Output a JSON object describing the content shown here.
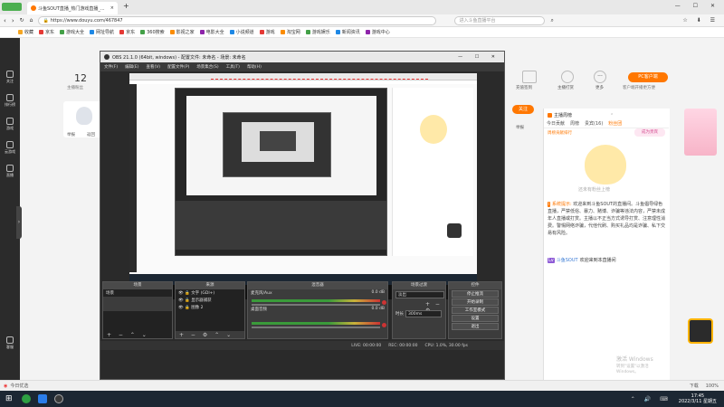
{
  "browser": {
    "brand": "360安全浏览器",
    "tab_title": "斗鱼SOUT直播_热门游戏直播_...",
    "new_tab_symbol": "+",
    "url": "https://www.douyu.com/467847",
    "search_placeholder": "进入斗鱼直播平台",
    "bookmarks": [
      "收藏",
      "京东",
      "游戏大全",
      "网址导航",
      "京东",
      "360搜索",
      "影视之家",
      "电影大全",
      "小说频道",
      "游戏",
      "淘宝网",
      "游戏娱乐",
      "新闻资讯",
      "游戏中心"
    ]
  },
  "sidebar": {
    "items": [
      {
        "label": "关注"
      },
      {
        "label": "排行榜"
      },
      {
        "label": "游戏"
      },
      {
        "label": "云游戏"
      },
      {
        "label": "直播"
      },
      {
        "label": "客服"
      }
    ]
  },
  "page": {
    "follow_count": "12",
    "follow_label": "主播粉丝",
    "room_actions": [
      "充值签到",
      "主播打赏",
      "更多"
    ],
    "pc_client_btn": "PC客户端",
    "pc_client_sub": "客户端开播更方便",
    "report_label": "举报",
    "follow_btn": "关注",
    "side_labels": [
      "举报",
      "返回"
    ]
  },
  "obs": {
    "title": "OBS 21.1.0 (64bit, windows) - 配置文件: 未命名 - 场景: 未命名",
    "menus": [
      "文件(F)",
      "编辑(E)",
      "查看(V)",
      "配置文件(P)",
      "场景集合(S)",
      "工具(T)",
      "帮助(H)"
    ],
    "docks": {
      "scenes": {
        "title": "场景",
        "items": [
          "场景"
        ]
      },
      "sources": {
        "title": "来源",
        "items": [
          "文字 (GDI+)",
          "显示器捕获",
          "图像 2"
        ]
      },
      "mixer": {
        "title": "混音器",
        "tracks": [
          "麦克风/Aux",
          "桌面音频"
        ],
        "levels": [
          "0.0 dB",
          "0.0 dB"
        ]
      },
      "transitions": {
        "title": "场景过渡",
        "type": "淡出",
        "duration_label": "时长",
        "duration": "300ms"
      },
      "controls": {
        "title": "控件",
        "buttons": [
          "停止推流",
          "开始录制",
          "工作室模式",
          "设置",
          "退出"
        ]
      }
    },
    "status": {
      "live": "LIVE: 00:00:00",
      "rec": "REC: 00:00:00",
      "cpu": "CPU: 1.0%, 30.00 fps"
    }
  },
  "right_panel": {
    "tabs": [
      "今日贡献",
      "周榜",
      "贵宾(16)",
      "粉丝团"
    ],
    "rank_label": "主播周榜",
    "rank_btn": "周榜贡献排行",
    "rank_btn2": "成为贵宾",
    "empty_text": "还未有粉丝上榜",
    "system_msg_tag": "系统提示:",
    "system_msg": "欢迎来到斗鱼SOUT的直播间。斗鱼倡导绿色直播，严禁低俗、暴力、赌博、诈骗等违法内容，严禁未成年人直播或打赏。主播以不正当方式诱导打赏、注意理性消费。警惕网络诈骗，代他代刷、购买礼品均是诈骗、私下交易有风险。",
    "welcome_msg": "欢迎来到本直播间",
    "welcome_user": "斗鱼SOUT"
  },
  "watermark": {
    "line1": "激活 Windows",
    "line2": "转到\"设置\"以激活 Windows。"
  },
  "statusstrip": {
    "left": "今日优选",
    "right_items": [
      "下载",
      "100%"
    ]
  },
  "taskbar": {
    "time": "17:45",
    "date": "2022/3/11 星期五"
  },
  "colors": {
    "accent": "#ff7700",
    "obs_bg": "#2a2a2a",
    "taskbar": "#1c2733"
  }
}
